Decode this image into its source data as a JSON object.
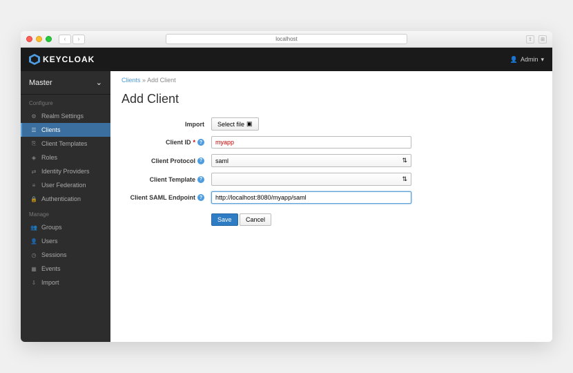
{
  "browser": {
    "url": "localhost"
  },
  "header": {
    "brand": "KEYCLOAK",
    "user": "Admin"
  },
  "sidebar": {
    "realm": "Master",
    "sections": {
      "configure": {
        "label": "Configure",
        "items": [
          {
            "label": "Realm Settings",
            "icon": "sliders"
          },
          {
            "label": "Clients",
            "icon": "list",
            "active": true
          },
          {
            "label": "Client Templates",
            "icon": "copy"
          },
          {
            "label": "Roles",
            "icon": "bookmark"
          },
          {
            "label": "Identity Providers",
            "icon": "link"
          },
          {
            "label": "User Federation",
            "icon": "layers"
          },
          {
            "label": "Authentication",
            "icon": "lock"
          }
        ]
      },
      "manage": {
        "label": "Manage",
        "items": [
          {
            "label": "Groups",
            "icon": "users"
          },
          {
            "label": "Users",
            "icon": "user"
          },
          {
            "label": "Sessions",
            "icon": "clock"
          },
          {
            "label": "Events",
            "icon": "calendar"
          },
          {
            "label": "Import",
            "icon": "download"
          }
        ]
      }
    }
  },
  "breadcrumb": {
    "root": "Clients",
    "sep": "»",
    "current": "Add Client"
  },
  "page": {
    "title": "Add Client"
  },
  "form": {
    "import": {
      "label": "Import",
      "button": "Select file"
    },
    "client_id": {
      "label": "Client ID",
      "value": "myapp"
    },
    "protocol": {
      "label": "Client Protocol",
      "value": "saml"
    },
    "template": {
      "label": "Client Template",
      "value": ""
    },
    "endpoint": {
      "label": "Client SAML Endpoint",
      "value": "http://localhost:8080/myapp/saml"
    },
    "save": "Save",
    "cancel": "Cancel"
  }
}
